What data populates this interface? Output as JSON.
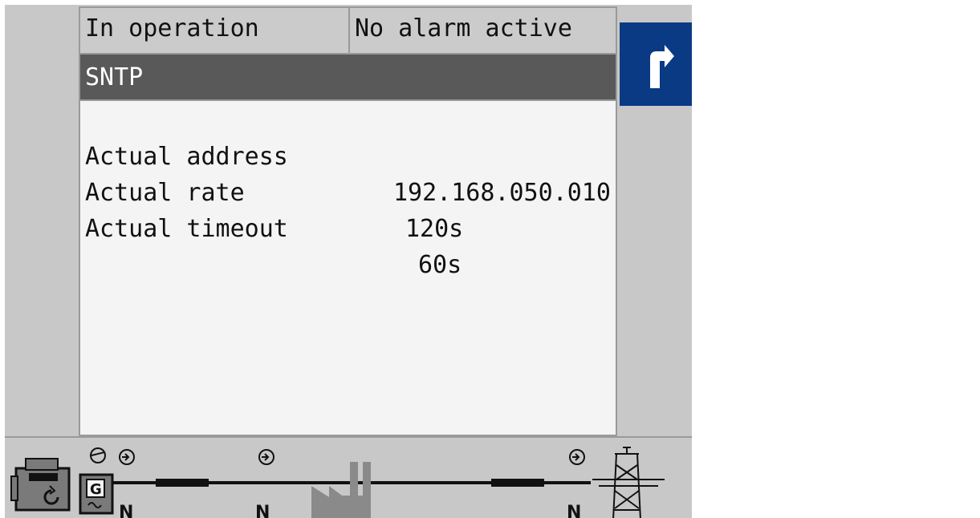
{
  "header": {
    "status_operation": "In operation",
    "status_alarm": "No alarm active"
  },
  "page_title": "SNTP",
  "rows": [
    {
      "label": "Actual address",
      "value": "192.168.050.010"
    },
    {
      "label": "Actual rate",
      "value": "120s"
    },
    {
      "label": "Actual timeout",
      "value": "60s"
    }
  ],
  "nav": {
    "back_icon": "return-arrow-icon"
  },
  "single_line_diagram": {
    "generator_label": "G",
    "icons": [
      "engine-icon",
      "generator-icon",
      "breaker-icon",
      "factory-load-icon",
      "mains-tower-icon"
    ]
  },
  "colors": {
    "accent": "#0b3a84",
    "title_bar": "#595959",
    "background": "#c8c8c8"
  }
}
